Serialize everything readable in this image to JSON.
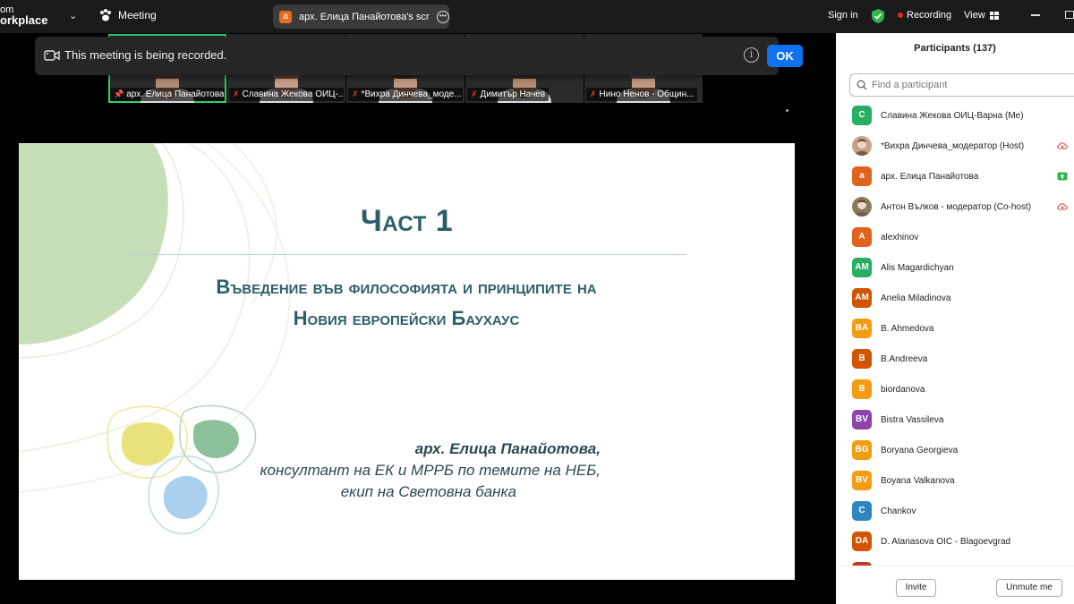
{
  "topbar": {
    "brand_line1": "om",
    "brand_line2": "orkplace",
    "meeting_label": "Meeting",
    "share_avatar": "a",
    "share_title": "арх. Елица Панайотова's screen",
    "signin_label": "Sign in",
    "recording_label": "Recording",
    "view_label": "View"
  },
  "banner": {
    "text": "This meeting is being recorded.",
    "info_glyph": "i",
    "ok_label": "OK"
  },
  "video_strip": [
    {
      "name": "арх. Елица Панайотова",
      "pinned": true,
      "muted": false,
      "active": true
    },
    {
      "name": "Славина Жекова ОИЦ-...",
      "pinned": false,
      "muted": true,
      "active": false
    },
    {
      "name": "*Вихра Динчева_моде...",
      "pinned": false,
      "muted": true,
      "active": false
    },
    {
      "name": "Димитър Начев",
      "pinned": false,
      "muted": true,
      "active": false
    },
    {
      "name": "Нино Ненов - Общин...",
      "pinned": false,
      "muted": true,
      "active": false
    }
  ],
  "slide": {
    "title": "Част 1",
    "subtitle_line1": "Въведение във философията и принципите на",
    "subtitle_line2": "Новия европейски Баухаус",
    "author_name": "арх. Елица Панайотова,",
    "author_line2": "консултант на ЕК и МРРБ по темите на НЕБ,",
    "author_line3": "екип на Световна банка"
  },
  "participants": {
    "header": "Participants (137)",
    "search_placeholder": "Find a participant",
    "items": [
      {
        "initials": "C",
        "color": "#27ae60",
        "name": "Славина Жекова ОИЦ-Варна (Me)",
        "status": "none"
      },
      {
        "initials": "",
        "color": "#c9a28a",
        "name": "*Вихра Динчева_модератор (Host)",
        "status": "cloud-red"
      },
      {
        "initials": "a",
        "color": "#e0621c",
        "name": "арх. Елица Панайотова",
        "status": "share-green"
      },
      {
        "initials": "",
        "color": "#8a7a5c",
        "name": "Антон Вълков - модератор (Co-host)",
        "status": "cloud-red"
      },
      {
        "initials": "A",
        "color": "#e0621c",
        "name": "alexhinov",
        "status": "none"
      },
      {
        "initials": "AM",
        "color": "#27ae60",
        "name": "Alis Magardichyan",
        "status": "none"
      },
      {
        "initials": "AM",
        "color": "#d35400",
        "name": "Anelia Miladinova",
        "status": "none"
      },
      {
        "initials": "BA",
        "color": "#f39c12",
        "name": "B. Ahmedova",
        "status": "none"
      },
      {
        "initials": "B",
        "color": "#d35400",
        "name": "B.Andreeva",
        "status": "none"
      },
      {
        "initials": "B",
        "color": "#f39c12",
        "name": "biordanova",
        "status": "none"
      },
      {
        "initials": "BV",
        "color": "#8e44ad",
        "name": "Bistra Vassileva",
        "status": "none"
      },
      {
        "initials": "BG",
        "color": "#f39c12",
        "name": "Boryana Georgieva",
        "status": "none"
      },
      {
        "initials": "BV",
        "color": "#f39c12",
        "name": "Boyana Valkanova",
        "status": "none"
      },
      {
        "initials": "C",
        "color": "#2e86c1",
        "name": "Chankov",
        "status": "none"
      },
      {
        "initials": "DA",
        "color": "#d35400",
        "name": "D. Atanasova OIC - Blagoevgrad",
        "status": "none"
      }
    ],
    "invite_label": "Invite",
    "unmute_label": "Unmute me"
  },
  "colors": {
    "accent_blue": "#0e72ed",
    "recording_red": "#e02828",
    "slide_text": "#2c5e68",
    "active_speaker": "#2fd16d"
  }
}
